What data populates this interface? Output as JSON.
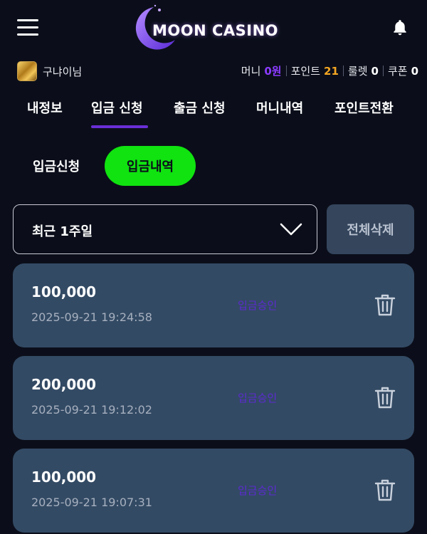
{
  "header": {
    "logo_text": "MOON CASINO"
  },
  "user": {
    "name": "구냐이님",
    "money_label": "머니",
    "money_value": "0원",
    "point_label": "포인트",
    "point_value": "21",
    "roulette_label": "룰렛",
    "roulette_value": "0",
    "coupon_label": "쿠폰",
    "coupon_value": "0"
  },
  "tabs": [
    {
      "label": "내정보"
    },
    {
      "label": "입금 신청"
    },
    {
      "label": "출금 신청"
    },
    {
      "label": "머니내역"
    },
    {
      "label": "포인트전환"
    }
  ],
  "subtabs": {
    "request": "입금신청",
    "history": "입금내역"
  },
  "filter": {
    "selected": "최근 1주일",
    "delete_all": "전체삭제"
  },
  "records": [
    {
      "amount": "100,000",
      "datetime": "2025-09-21 19:24:58",
      "status": "입금승인"
    },
    {
      "amount": "200,000",
      "datetime": "2025-09-21 19:12:02",
      "status": "입금승인"
    },
    {
      "amount": "100,000",
      "datetime": "2025-09-21 19:07:31",
      "status": "입금승인"
    }
  ],
  "colors": {
    "background": "#0b0e1a",
    "accent_purple": "#6a2fd6",
    "money_color": "#8b3bff",
    "point_color": "#f5a623",
    "active_green": "#10e310",
    "card_bg": "#334a64"
  },
  "icons": {
    "menu": "hamburger-icon",
    "logo": "moon-crescent-icon",
    "notification": "bell-icon",
    "dropdown": "chevron-down-icon",
    "delete": "trash-icon"
  }
}
